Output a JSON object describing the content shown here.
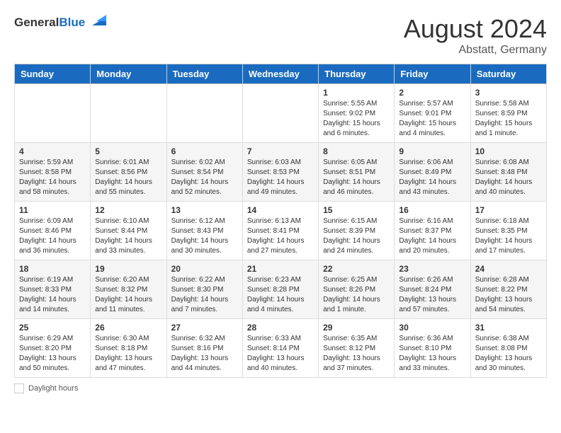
{
  "header": {
    "logo_general": "General",
    "logo_blue": "Blue",
    "month": "August 2024",
    "location": "Abstatt, Germany"
  },
  "days_of_week": [
    "Sunday",
    "Monday",
    "Tuesday",
    "Wednesday",
    "Thursday",
    "Friday",
    "Saturday"
  ],
  "legend": {
    "label": "Daylight hours"
  },
  "weeks": [
    [
      {
        "day": "",
        "info": ""
      },
      {
        "day": "",
        "info": ""
      },
      {
        "day": "",
        "info": ""
      },
      {
        "day": "",
        "info": ""
      },
      {
        "day": "1",
        "info": "Sunrise: 5:55 AM\nSunset: 9:02 PM\nDaylight: 15 hours\nand 6 minutes."
      },
      {
        "day": "2",
        "info": "Sunrise: 5:57 AM\nSunset: 9:01 PM\nDaylight: 15 hours\nand 4 minutes."
      },
      {
        "day": "3",
        "info": "Sunrise: 5:58 AM\nSunset: 8:59 PM\nDaylight: 15 hours\nand 1 minute."
      }
    ],
    [
      {
        "day": "4",
        "info": "Sunrise: 5:59 AM\nSunset: 8:58 PM\nDaylight: 14 hours\nand 58 minutes."
      },
      {
        "day": "5",
        "info": "Sunrise: 6:01 AM\nSunset: 8:56 PM\nDaylight: 14 hours\nand 55 minutes."
      },
      {
        "day": "6",
        "info": "Sunrise: 6:02 AM\nSunset: 8:54 PM\nDaylight: 14 hours\nand 52 minutes."
      },
      {
        "day": "7",
        "info": "Sunrise: 6:03 AM\nSunset: 8:53 PM\nDaylight: 14 hours\nand 49 minutes."
      },
      {
        "day": "8",
        "info": "Sunrise: 6:05 AM\nSunset: 8:51 PM\nDaylight: 14 hours\nand 46 minutes."
      },
      {
        "day": "9",
        "info": "Sunrise: 6:06 AM\nSunset: 8:49 PM\nDaylight: 14 hours\nand 43 minutes."
      },
      {
        "day": "10",
        "info": "Sunrise: 6:08 AM\nSunset: 8:48 PM\nDaylight: 14 hours\nand 40 minutes."
      }
    ],
    [
      {
        "day": "11",
        "info": "Sunrise: 6:09 AM\nSunset: 8:46 PM\nDaylight: 14 hours\nand 36 minutes."
      },
      {
        "day": "12",
        "info": "Sunrise: 6:10 AM\nSunset: 8:44 PM\nDaylight: 14 hours\nand 33 minutes."
      },
      {
        "day": "13",
        "info": "Sunrise: 6:12 AM\nSunset: 8:43 PM\nDaylight: 14 hours\nand 30 minutes."
      },
      {
        "day": "14",
        "info": "Sunrise: 6:13 AM\nSunset: 8:41 PM\nDaylight: 14 hours\nand 27 minutes."
      },
      {
        "day": "15",
        "info": "Sunrise: 6:15 AM\nSunset: 8:39 PM\nDaylight: 14 hours\nand 24 minutes."
      },
      {
        "day": "16",
        "info": "Sunrise: 6:16 AM\nSunset: 8:37 PM\nDaylight: 14 hours\nand 20 minutes."
      },
      {
        "day": "17",
        "info": "Sunrise: 6:18 AM\nSunset: 8:35 PM\nDaylight: 14 hours\nand 17 minutes."
      }
    ],
    [
      {
        "day": "18",
        "info": "Sunrise: 6:19 AM\nSunset: 8:33 PM\nDaylight: 14 hours\nand 14 minutes."
      },
      {
        "day": "19",
        "info": "Sunrise: 6:20 AM\nSunset: 8:32 PM\nDaylight: 14 hours\nand 11 minutes."
      },
      {
        "day": "20",
        "info": "Sunrise: 6:22 AM\nSunset: 8:30 PM\nDaylight: 14 hours\nand 7 minutes."
      },
      {
        "day": "21",
        "info": "Sunrise: 6:23 AM\nSunset: 8:28 PM\nDaylight: 14 hours\nand 4 minutes."
      },
      {
        "day": "22",
        "info": "Sunrise: 6:25 AM\nSunset: 8:26 PM\nDaylight: 14 hours\nand 1 minute."
      },
      {
        "day": "23",
        "info": "Sunrise: 6:26 AM\nSunset: 8:24 PM\nDaylight: 13 hours\nand 57 minutes."
      },
      {
        "day": "24",
        "info": "Sunrise: 6:28 AM\nSunset: 8:22 PM\nDaylight: 13 hours\nand 54 minutes."
      }
    ],
    [
      {
        "day": "25",
        "info": "Sunrise: 6:29 AM\nSunset: 8:20 PM\nDaylight: 13 hours\nand 50 minutes."
      },
      {
        "day": "26",
        "info": "Sunrise: 6:30 AM\nSunset: 8:18 PM\nDaylight: 13 hours\nand 47 minutes."
      },
      {
        "day": "27",
        "info": "Sunrise: 6:32 AM\nSunset: 8:16 PM\nDaylight: 13 hours\nand 44 minutes."
      },
      {
        "day": "28",
        "info": "Sunrise: 6:33 AM\nSunset: 8:14 PM\nDaylight: 13 hours\nand 40 minutes."
      },
      {
        "day": "29",
        "info": "Sunrise: 6:35 AM\nSunset: 8:12 PM\nDaylight: 13 hours\nand 37 minutes."
      },
      {
        "day": "30",
        "info": "Sunrise: 6:36 AM\nSunset: 8:10 PM\nDaylight: 13 hours\nand 33 minutes."
      },
      {
        "day": "31",
        "info": "Sunrise: 6:38 AM\nSunset: 8:08 PM\nDaylight: 13 hours\nand 30 minutes."
      }
    ]
  ]
}
